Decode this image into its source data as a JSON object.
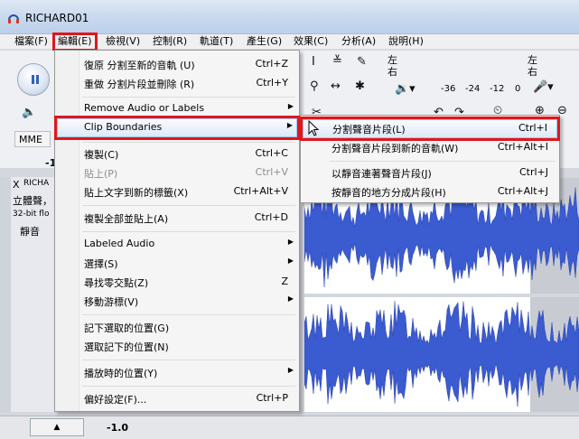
{
  "window": {
    "title": "RICHARD01"
  },
  "menubar": [
    {
      "label": "檔案(F)"
    },
    {
      "label": "編輯(E)"
    },
    {
      "label": "檢視(V)"
    },
    {
      "label": "控制(R)"
    },
    {
      "label": "軌道(T)"
    },
    {
      "label": "產生(G)"
    },
    {
      "label": "效果(C)"
    },
    {
      "label": "分析(A)"
    },
    {
      "label": "說明(H)"
    }
  ],
  "toolbar": {
    "meter_left": "左",
    "meter_right": "右",
    "meter_left2": "左",
    "meter_right2": "右",
    "scale": [
      "-36",
      "-24",
      "-12",
      "0"
    ],
    "device": "MME",
    "scale_left": "-1"
  },
  "track": {
    "name": "RICHA",
    "close": "X",
    "type": "立體聲，",
    "format": "32-bit flo",
    "mute": "靜音",
    "bottom_value": "-1.0"
  },
  "edit_menu": {
    "items": [
      {
        "label": "復原 分割至新的音軌 (U)",
        "shortcut": "Ctrl+Z"
      },
      {
        "label": "重做 分割片段並刪除 (R)",
        "shortcut": "Ctrl+Y"
      },
      {
        "label": "Remove Audio or Labels",
        "shortcut": ""
      },
      {
        "label": "Clip Boundaries",
        "shortcut": ""
      },
      {
        "label": "複製(C)",
        "shortcut": "Ctrl+C"
      },
      {
        "label": "貼上(P)",
        "shortcut": "Ctrl+V"
      },
      {
        "label": "貼上文字到新的標籤(X)",
        "shortcut": "Ctrl+Alt+V"
      },
      {
        "label": "複製全部並貼上(A)",
        "shortcut": "Ctrl+D"
      },
      {
        "label": "Labeled Audio",
        "shortcut": ""
      },
      {
        "label": "選擇(S)",
        "shortcut": ""
      },
      {
        "label": "尋找零交點(Z)",
        "shortcut": "Z"
      },
      {
        "label": "移動游標(V)",
        "shortcut": ""
      },
      {
        "label": "記下選取的位置(G)",
        "shortcut": ""
      },
      {
        "label": "選取記下的位置(N)",
        "shortcut": ""
      },
      {
        "label": "播放時的位置(Y)",
        "shortcut": ""
      },
      {
        "label": "偏好設定(F)...",
        "shortcut": "Ctrl+P"
      }
    ]
  },
  "clip_submenu": {
    "items": [
      {
        "label": "分割聲音片段(L)",
        "shortcut": "Ctrl+I"
      },
      {
        "label": "分割聲音片段到新的音軌(W)",
        "shortcut": "Ctrl+Alt+I"
      },
      {
        "label": "以靜音連著聲音片段(J)",
        "shortcut": "Ctrl+J"
      },
      {
        "label": "按靜音的地方分成片段(H)",
        "shortcut": "Ctrl+Alt+J"
      }
    ]
  },
  "colors": {
    "accent_red": "#e0161b",
    "wave_blue": "#3b5bd1",
    "highlight": "#dde9f7"
  }
}
